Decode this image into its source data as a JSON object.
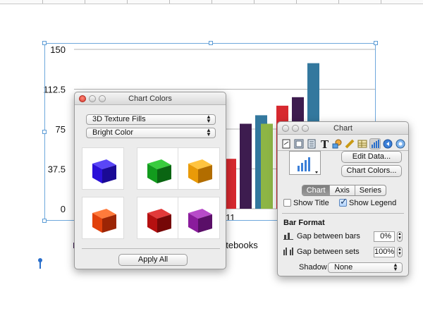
{
  "chart_data": {
    "type": "bar",
    "title": "",
    "xlabel": "",
    "ylabel": "",
    "ylim": [
      0,
      150
    ],
    "yticks": [
      "150",
      "112.5",
      "75",
      "37.5",
      "0"
    ],
    "visible_x_labels": [
      "11",
      "otebooks"
    ],
    "grid": "horizontal",
    "series": [
      {
        "color": "#8db545",
        "values": [
          65,
          80
        ]
      },
      {
        "color": "#d7292f",
        "values": [
          47,
          97
        ]
      },
      {
        "color": "#3d1c4f",
        "values": [
          80,
          105
        ]
      },
      {
        "color": "#33789e",
        "values": [
          88,
          137
        ]
      }
    ]
  },
  "chart_colors": {
    "title": "Chart Colors",
    "fill_type": "3D Texture Fills",
    "palette": "Bright Color",
    "swatches": [
      {
        "name": "blue-cube-swatch",
        "front": "#2a10d8",
        "top": "#5a46f7",
        "side": "#1a0a95"
      },
      {
        "name": "green-cube-swatch",
        "front": "#129b1d",
        "top": "#39cc3e",
        "side": "#0a6512"
      },
      {
        "name": "orange-cube-swatch",
        "front": "#e99a08",
        "top": "#ffc440",
        "side": "#b26d00"
      },
      {
        "name": "red-orange-cube-swatch",
        "front": "#e1410b",
        "top": "#ff7a3b",
        "side": "#9c2505"
      },
      {
        "name": "dark-red-cube-swatch",
        "front": "#b51010",
        "top": "#e23a3a",
        "side": "#760707"
      },
      {
        "name": "purple-cube-swatch",
        "front": "#8a1c9c",
        "top": "#b74bc9",
        "side": "#5a0f68"
      }
    ],
    "apply_label": "Apply All"
  },
  "inspector": {
    "title": "Chart",
    "edit_data_label": "Edit Data...",
    "chart_colors_label": "Chart Colors...",
    "tabs": [
      {
        "label": "Chart",
        "active": true
      },
      {
        "label": "Axis",
        "active": false
      },
      {
        "label": "Series",
        "active": false
      }
    ],
    "show_title_label": "Show Title",
    "show_title_checked": false,
    "show_legend_label": "Show Legend",
    "show_legend_checked": true,
    "bar_format_label": "Bar Format",
    "gap_bars_label": "Gap between bars",
    "gap_bars_value": "0%",
    "gap_sets_label": "Gap between sets",
    "gap_sets_value": "100%",
    "shadow_label": "Shadow",
    "shadow_value": "None"
  }
}
